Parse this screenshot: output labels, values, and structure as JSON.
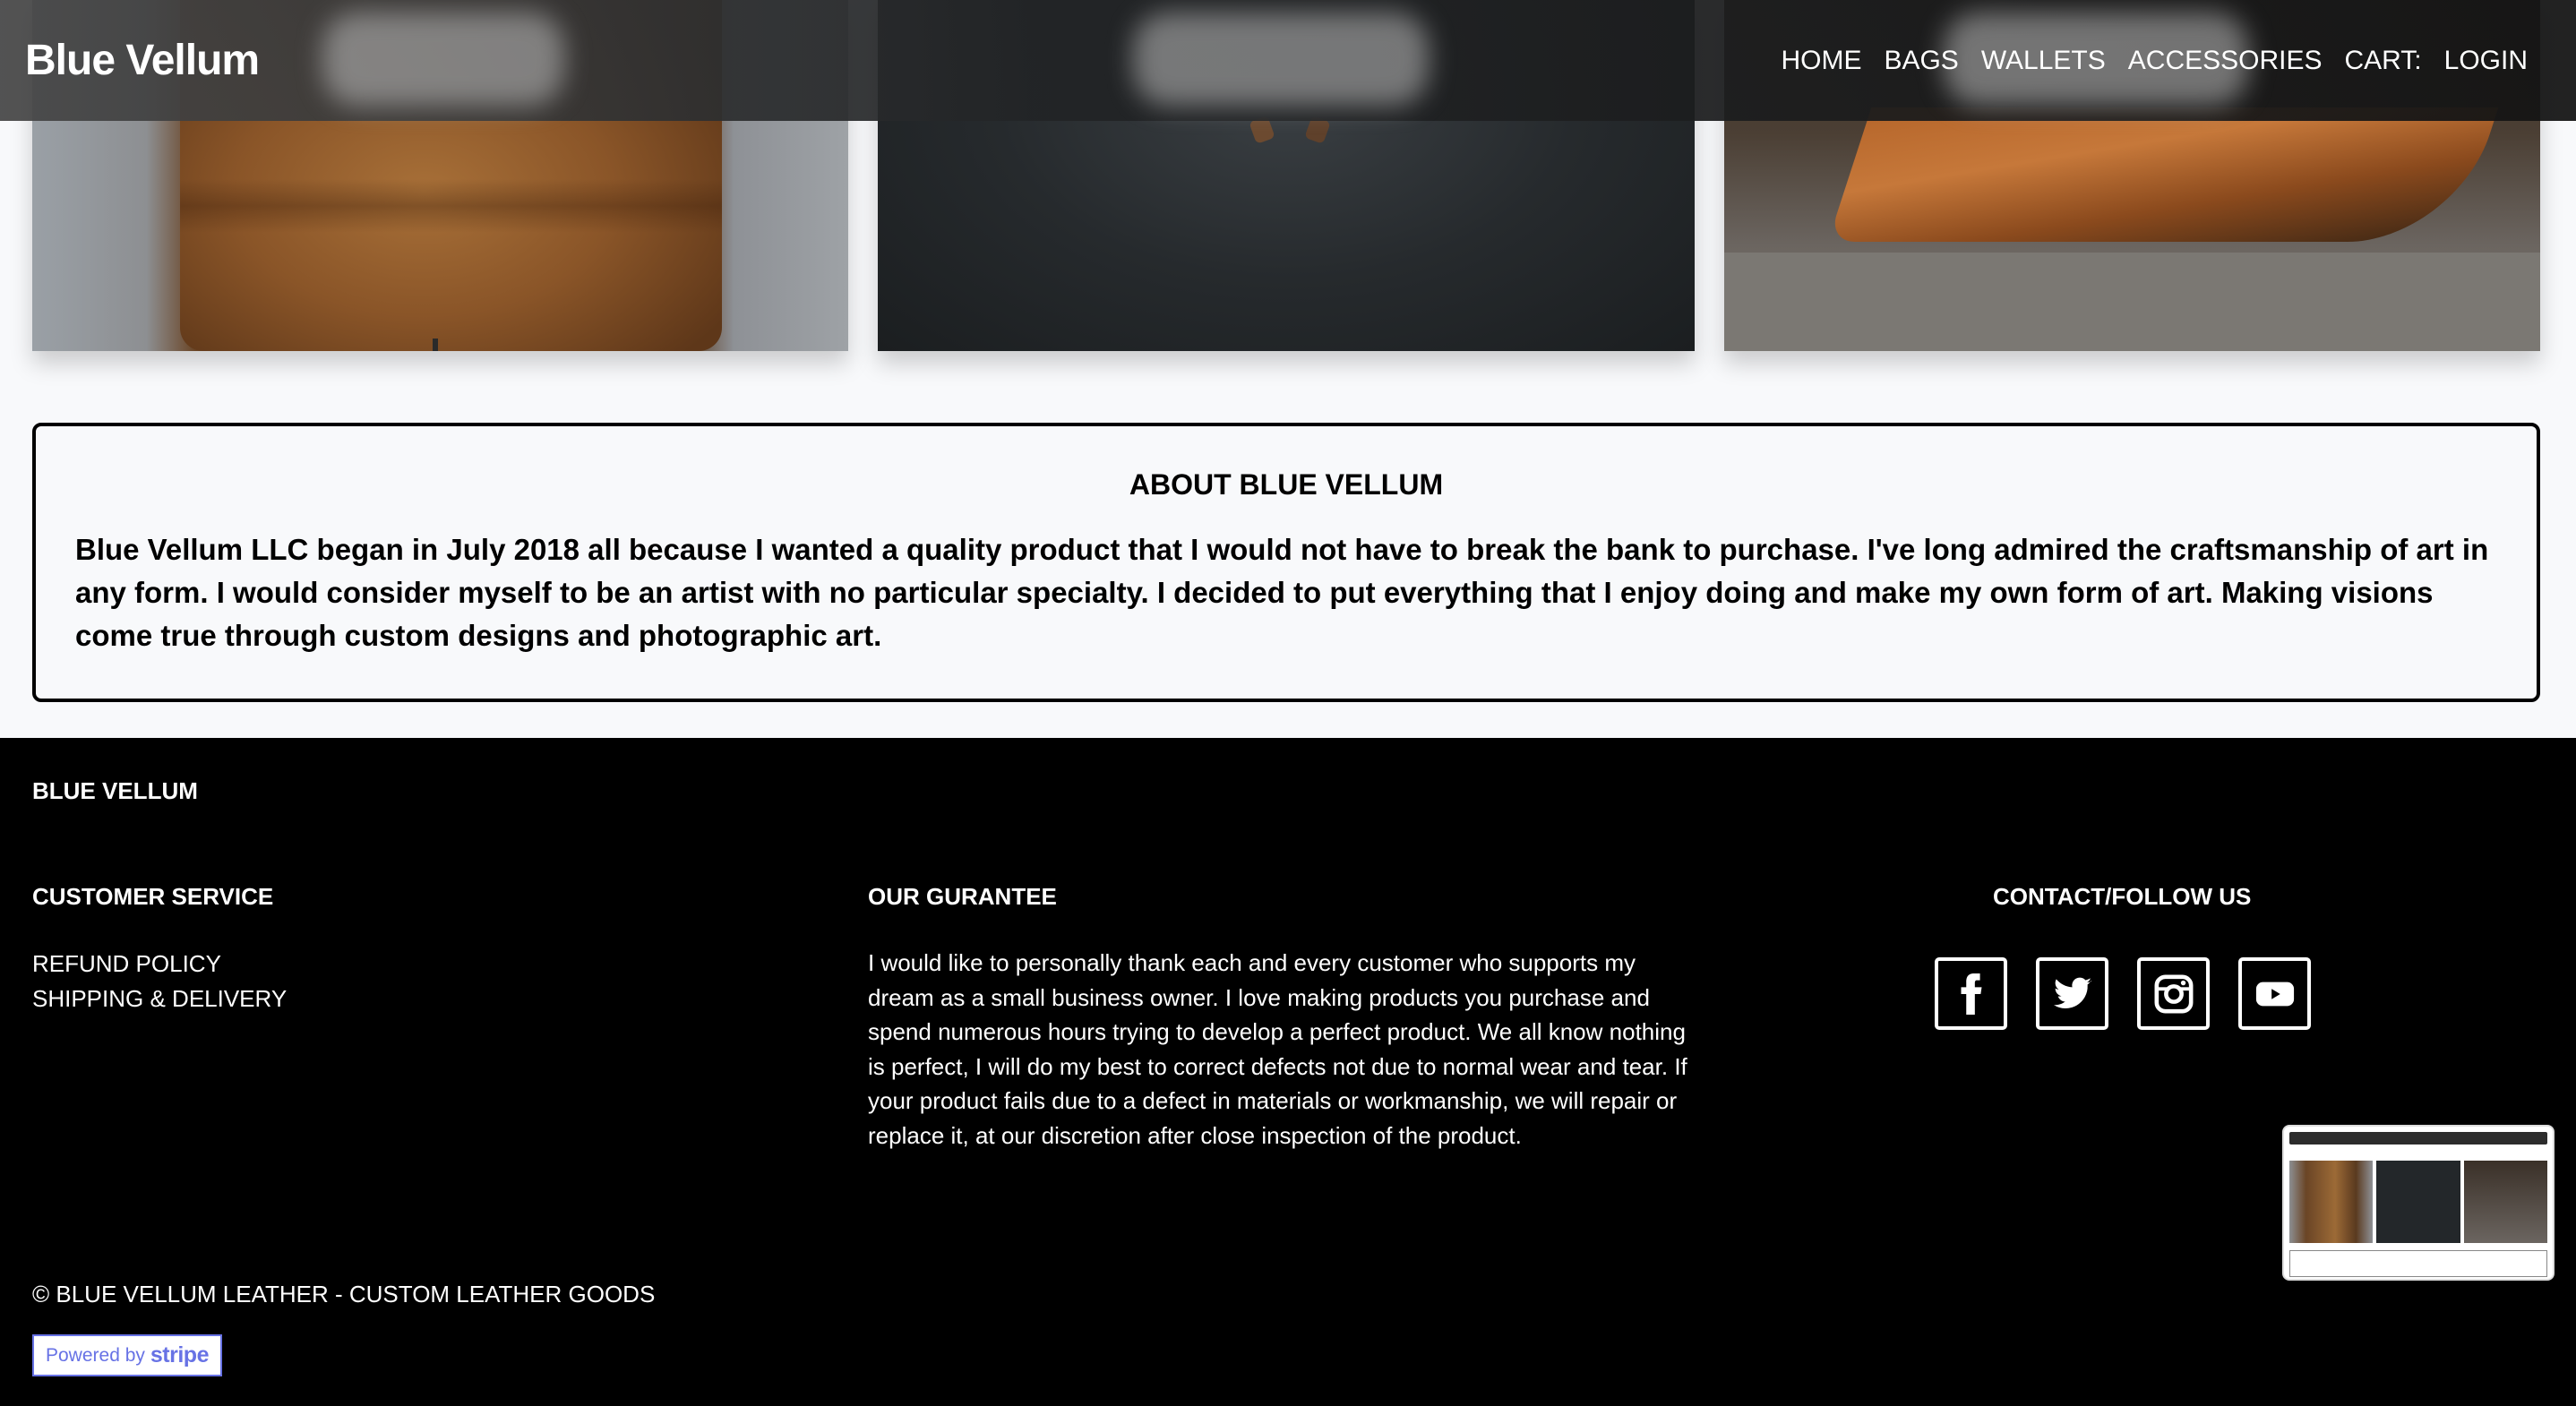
{
  "header": {
    "brand": "Blue Vellum",
    "nav": [
      "HOME",
      "BAGS",
      "WALLETS",
      "ACCESSORIES",
      "CART:",
      "LOGIN"
    ]
  },
  "about": {
    "title": "ABOUT BLUE VELLUM",
    "body": "Blue Vellum LLC began in July 2018 all because I wanted a quality product that I would not have to break the bank to purchase. I've long admired the craftsmanship of art in any form. I would consider myself to be an artist with no particular specialty. I decided to put everything that I enjoy doing and make my own form of art. Making visions come true through custom designs and photographic art."
  },
  "footer": {
    "brand": "BLUE VELLUM",
    "customer_service": {
      "heading": "CUSTOMER SERVICE",
      "links": [
        "REFUND POLICY",
        "SHIPPING & DELIVERY"
      ]
    },
    "guarantee": {
      "heading": "OUR GURANTEE",
      "text": "I would like to personally thank each and every customer who supports my dream as a small business owner. I love making products you purchase and spend numerous hours trying to develop a perfect product. We all know nothing is perfect, I will do my best to correct defects not due to normal wear and tear. If your product fails due to a defect in materials or workmanship, we will repair or replace it, at our discretion after close inspection of the product."
    },
    "contact": {
      "heading": "CONTACT/FOLLOW US",
      "icons": [
        "facebook-icon",
        "twitter-icon",
        "instagram-icon",
        "youtube-icon"
      ]
    },
    "copyright": "© BLUE VELLUM LEATHER - CUSTOM LEATHER GOODS",
    "stripe": {
      "powered_by": "Powered by",
      "brand": "stripe"
    }
  },
  "colors": {
    "footer_bg": "#000000",
    "page_bg": "#f8f9fb",
    "stripe_accent": "#6772e5"
  }
}
